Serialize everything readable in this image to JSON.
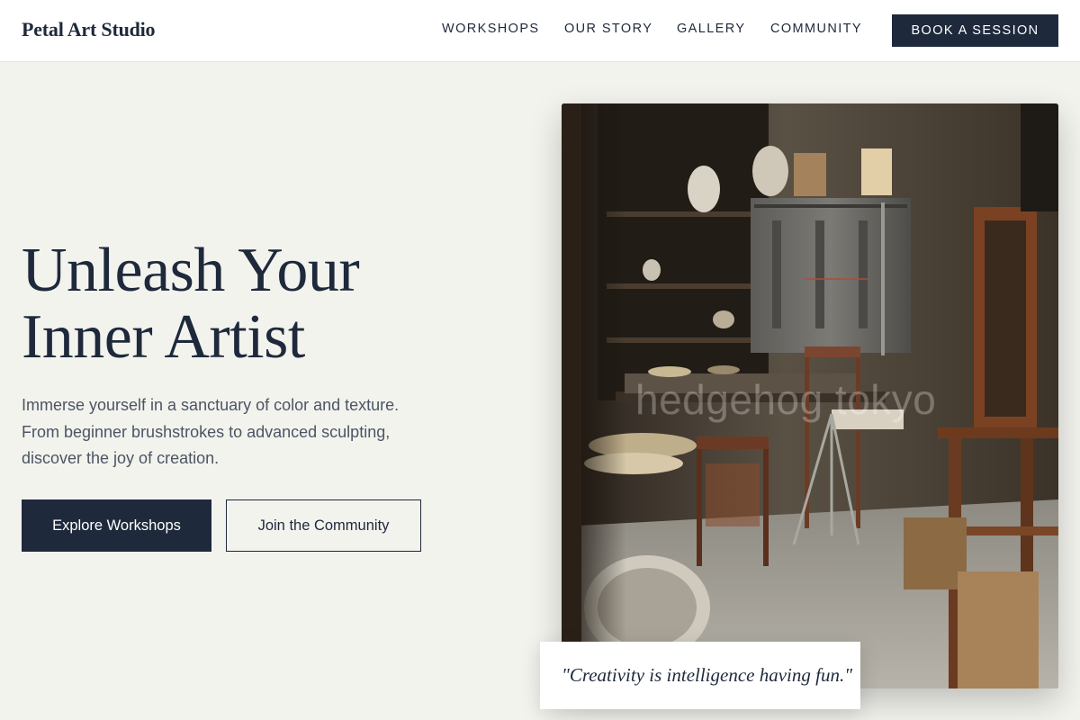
{
  "brand": {
    "name": "Petal Art Studio"
  },
  "nav": {
    "links": [
      {
        "label": "WORKSHOPS"
      },
      {
        "label": "OUR STORY"
      },
      {
        "label": "GALLERY"
      },
      {
        "label": "COMMUNITY"
      }
    ],
    "cta_label": "BOOK A SESSION"
  },
  "hero": {
    "title_line1": "Unleash Your",
    "title_line2": "Inner Artist",
    "subtitle": "Immerse yourself in a sanctuary of color and texture. From beginner brushstrokes to advanced sculpting, discover the joy of creation.",
    "primary_button": "Explore Workshops",
    "secondary_button": "Join the Community"
  },
  "image": {
    "watermark": "hedgehog tokyo"
  },
  "quote": {
    "text": "\"Creativity is intelligence having fun.\""
  },
  "colors": {
    "primary": "#1e293b",
    "background": "#f3f3ee",
    "header_bg": "#ffffff",
    "body_text": "#4b5563"
  }
}
